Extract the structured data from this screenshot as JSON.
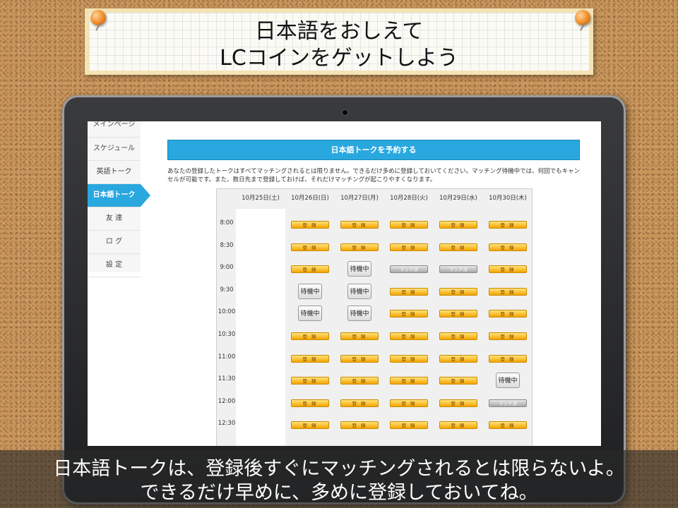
{
  "title_card": {
    "line1": "日本語をおしえて",
    "line2": "LCコインをゲットしよう"
  },
  "sidebar": {
    "items": [
      {
        "label": "メインページ",
        "active": false
      },
      {
        "label": "スケジュール",
        "active": false
      },
      {
        "label": "英語トーク",
        "active": false
      },
      {
        "label": "日本語トーク",
        "active": true
      },
      {
        "label": "友 達",
        "active": false
      },
      {
        "label": "ロ グ",
        "active": false
      },
      {
        "label": "設 定",
        "active": false
      }
    ]
  },
  "page": {
    "banner": "日本語トークを予約する",
    "description": "あなたの登録したトークはすべてマッチングされるとは限りません。できるだけ多めに登録しておいてください。マッチング待機中では、何回でもキャンセルが可能です。また、数日先まで登録しておけば、それだけマッチングが起こりやすくなります。"
  },
  "schedule": {
    "days": [
      "10月25日(土)",
      "10月26日(日)",
      "10月27日(月)",
      "10月28日(火)",
      "10月29日(水)",
      "10月30日(木)"
    ],
    "times": [
      "8:00",
      "8:30",
      "9:00",
      "9:30",
      "10:00",
      "10:30",
      "11:00",
      "11:30",
      "12:00",
      "12:30"
    ],
    "register_label": "登 録",
    "waiting_label": "待機中",
    "grid": [
      [
        "",
        "reg",
        "reg",
        "reg",
        "reg",
        "reg"
      ],
      [
        "",
        "reg",
        "reg",
        "reg",
        "reg",
        "reg"
      ],
      [
        "",
        "reg",
        "wait",
        "gray",
        "gray",
        "reg"
      ],
      [
        "",
        "wait",
        "wait",
        "reg",
        "reg",
        "reg"
      ],
      [
        "",
        "wait",
        "wait",
        "reg",
        "reg",
        "reg"
      ],
      [
        "",
        "reg",
        "reg",
        "reg",
        "reg",
        "reg"
      ],
      [
        "",
        "reg",
        "reg",
        "reg",
        "reg",
        "reg"
      ],
      [
        "",
        "reg",
        "reg",
        "reg",
        "reg",
        "wait"
      ],
      [
        "",
        "reg",
        "reg",
        "reg",
        "reg",
        "gray"
      ],
      [
        "",
        "reg",
        "reg",
        "reg",
        "reg",
        "reg"
      ]
    ],
    "gray_label": "マッチ済"
  },
  "subtitles": {
    "line1": "日本語トークは、登録後すぐにマッチングされるとは限らないよ。",
    "line2": "できるだけ早めに、多めに登録しておいてね。"
  },
  "colors": {
    "accent": "#29a7df",
    "register": "#f5a400",
    "cork": "#c7955c"
  }
}
